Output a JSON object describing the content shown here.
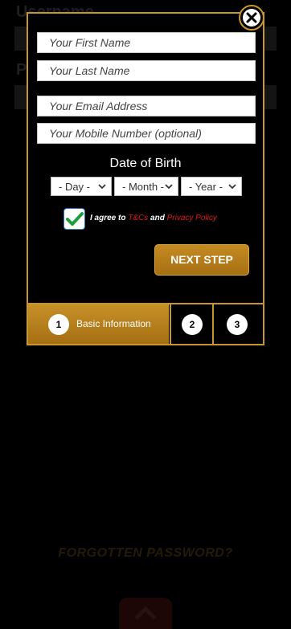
{
  "background": {
    "username_label": "Username",
    "password_label": "P",
    "forgot_password": "FORGOTTEN PASSWORD?"
  },
  "form": {
    "first_name_placeholder": "Your First Name",
    "last_name_placeholder": "Your Last Name",
    "email_placeholder": "Your Email Address",
    "mobile_placeholder": "Your Mobile Number (optional)",
    "dob_title": "Date of Birth",
    "day_select": "- Day -",
    "month_select": "- Month -",
    "year_select": "- Year -",
    "terms_checked": true,
    "agree_prefix": "I agree to",
    "terms_link": "T&Cs",
    "agree_and": "and",
    "privacy_link": "Privacy Policy",
    "next_button": "NEXT STEP"
  },
  "steps": [
    {
      "number": "1",
      "label": "Basic Information",
      "active": true
    },
    {
      "number": "2"
    },
    {
      "number": "3"
    }
  ],
  "colors": {
    "accent_gold": "#c9962e",
    "link_red": "#e01818",
    "check_green": "#1f9e3c"
  },
  "icons": {
    "close": "close-icon",
    "check": "checkmark-icon",
    "select": "chevron-down-icon",
    "scroll_top": "chevron-up-icon"
  }
}
